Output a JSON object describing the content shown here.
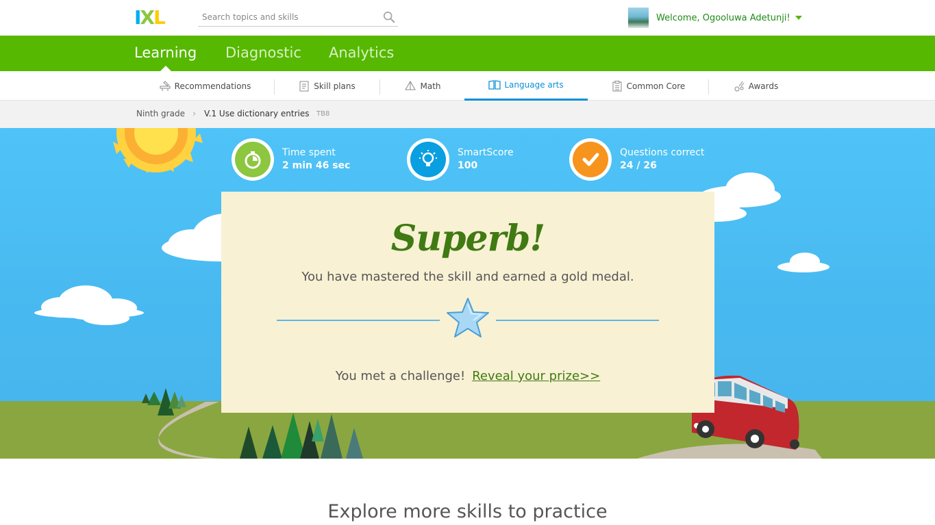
{
  "header": {
    "logo_text": "IXL",
    "search_placeholder": "Search topics and skills",
    "welcome": "Welcome, Ogooluwa Adetunji!"
  },
  "main_nav": {
    "tabs": [
      {
        "label": "Learning",
        "active": true
      },
      {
        "label": "Diagnostic",
        "active": false
      },
      {
        "label": "Analytics",
        "active": false
      }
    ]
  },
  "sub_nav": {
    "tabs": [
      {
        "label": "Recommendations",
        "icon": "recommendations-icon"
      },
      {
        "label": "Skill plans",
        "icon": "skill-plans-icon"
      },
      {
        "label": "Math",
        "icon": "math-pyramid-icon"
      },
      {
        "label": "Language arts",
        "icon": "book-icon",
        "active": true
      },
      {
        "label": "Common Core",
        "icon": "clipboard-icon"
      },
      {
        "label": "Awards",
        "icon": "awards-icon"
      }
    ]
  },
  "breadcrumb": {
    "grade": "Ninth grade",
    "skill": "V.1 Use dictionary entries",
    "code": "TB8"
  },
  "stats": {
    "time": {
      "label": "Time spent",
      "value": "2 min 46 sec",
      "icon": "stopwatch-icon",
      "color": "#8dc63f"
    },
    "score": {
      "label": "SmartScore",
      "value": "100",
      "icon": "lightbulb-icon",
      "color": "#0a9fe0"
    },
    "questions": {
      "label": "Questions correct",
      "value": "24 / 26",
      "icon": "checkmark-icon",
      "color": "#f7941d"
    }
  },
  "result": {
    "headline": "Superb!",
    "message": "You have mastered the skill and earned a gold medal.",
    "challenge_text": "You met a challenge!",
    "prize_link": "Reveal your prize>>"
  },
  "footer": {
    "explore": "Explore more skills to practice"
  },
  "colors": {
    "brand_green": "#56b800",
    "accent_blue": "#0a8fd8",
    "sky": "#4fc3f7",
    "card_bg": "#f8f1d4",
    "headline_green": "#3f7a12"
  }
}
